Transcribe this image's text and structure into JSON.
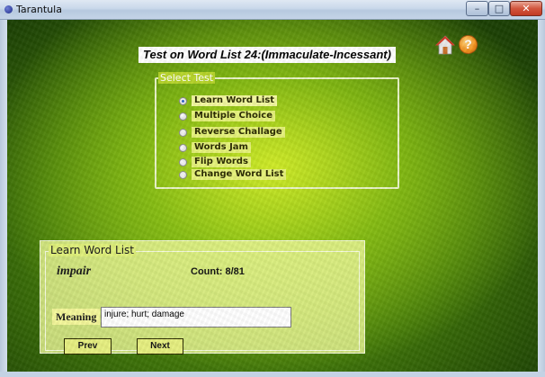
{
  "window": {
    "title": "Tarantula",
    "controls": [
      "minimize",
      "maximize",
      "close"
    ]
  },
  "header": {
    "title": "Test on Word List 24:(Immaculate-Incessant)",
    "icons": [
      "home-icon",
      "help-icon"
    ],
    "help_glyph": "?"
  },
  "select_test": {
    "legend": "Select Test",
    "selected": "Learn Word List",
    "options": [
      {
        "label": "Learn Word List",
        "checked": true
      },
      {
        "label": "Multiple Choice",
        "checked": false
      },
      {
        "label": "Reverse Challage",
        "checked": false
      },
      {
        "label": "Words Jam",
        "checked": false
      },
      {
        "label": "Flip Words",
        "checked": false
      },
      {
        "label": "Change Word List",
        "checked": false
      }
    ]
  },
  "learn": {
    "legend": "Learn Word List",
    "word": "impair",
    "count": "Count: 8/81",
    "meaning_label": "Meaning",
    "meaning_value": "injure; hurt; damage",
    "prev_label": "Prev",
    "next_label": "Next"
  },
  "colors": {
    "background_green": "#6fa514",
    "highlight_yellow": "#e5f27a",
    "help_orange": "#f2901c",
    "home_red": "#d33a25"
  }
}
